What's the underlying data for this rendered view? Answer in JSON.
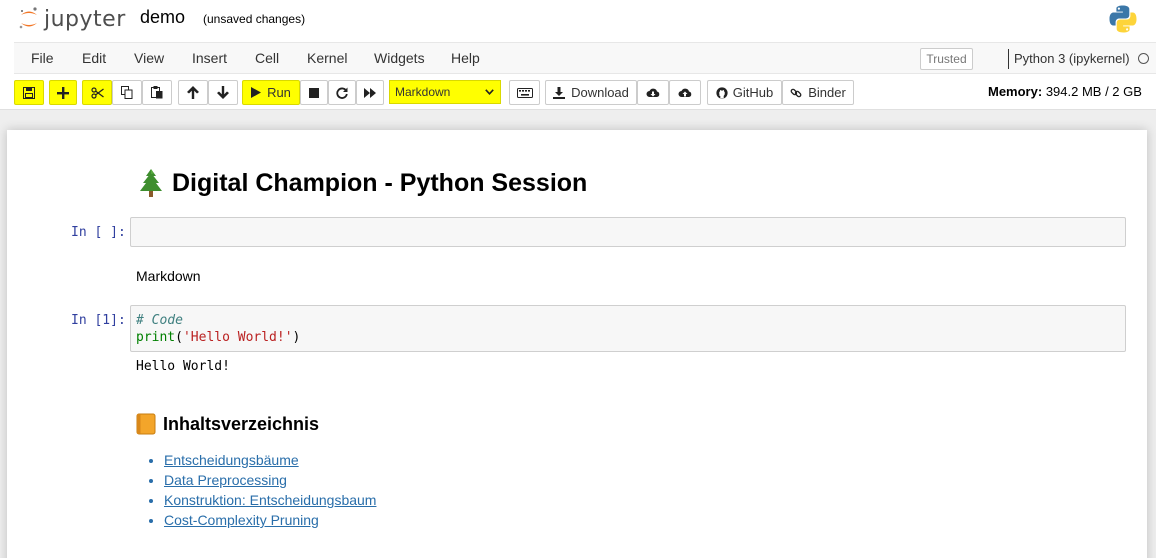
{
  "header": {
    "logo_text": "jupyter",
    "notebook_name": "demo",
    "save_status": "(unsaved changes)"
  },
  "menu": [
    "File",
    "Edit",
    "View",
    "Insert",
    "Cell",
    "Kernel",
    "Widgets",
    "Help"
  ],
  "trusted_label": "Trusted",
  "kernel_name": "Python 3 (ipykernel)",
  "toolbar": {
    "run_label": "Run",
    "cell_type": "Markdown",
    "download_label": "Download",
    "github_label": "GitHub",
    "binder_label": "Binder",
    "highlight_color": "#ffff00"
  },
  "memory": {
    "label": "Memory:",
    "value": "394.2 MB / 2 GB"
  },
  "cells": {
    "title": "Digital Champion - Python Session",
    "title_emoji": "evergreen-tree-icon",
    "empty_prompt": "In [ ]:",
    "markdown_text": "Markdown",
    "code_prompt": "In [1]:",
    "code_comment": "# Code",
    "code_fn": "print",
    "code_open": "(",
    "code_string": "'Hello World!'",
    "code_close": ")",
    "output": "Hello World!",
    "toc_title": "Inhaltsverzeichnis",
    "toc_emoji": "book-icon",
    "toc_items": [
      "Entscheidungsbäume",
      "Data Preprocessing",
      "Konstruktion: Entscheidungsbaum",
      "Cost-Complexity Pruning"
    ]
  }
}
